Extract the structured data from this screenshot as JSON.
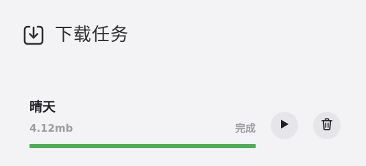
{
  "header": {
    "title": "下载任务",
    "icon": "download-box-icon"
  },
  "task": {
    "name": "晴天",
    "size": "4.12mb",
    "status": "完成",
    "progress_percent": 100,
    "progress_color": "#4caf50",
    "play_icon": "play-icon",
    "delete_icon": "trash-icon"
  }
}
